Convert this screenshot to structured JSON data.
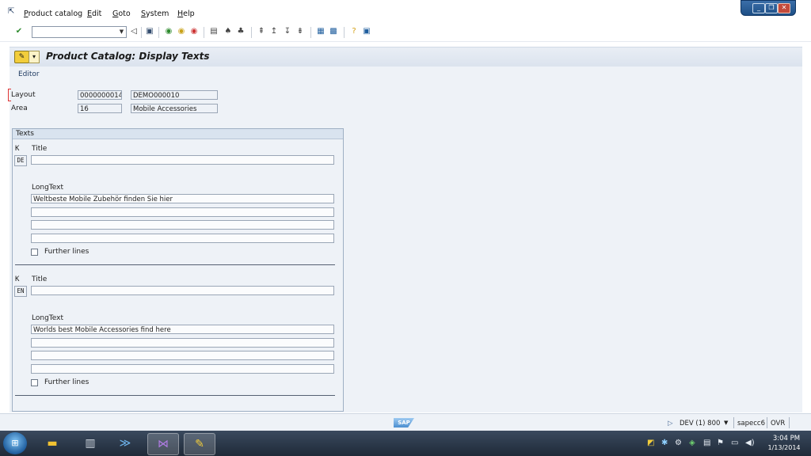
{
  "menu": [
    {
      "u": "P",
      "rest": "roduct catalog"
    },
    {
      "u": "E",
      "rest": "dit"
    },
    {
      "u": "G",
      "rest": "oto"
    },
    {
      "u": "S",
      "rest": "ystem"
    },
    {
      "u": "H",
      "rest": "elp"
    }
  ],
  "window_controls": {
    "minimize": "_",
    "restore": "❐",
    "close": "✕"
  },
  "toolbar": {
    "command_value": ""
  },
  "header": {
    "title": "Product Catalog: Display Texts"
  },
  "appbar": {
    "editor_label": "Editor"
  },
  "fields": {
    "layout_label": "Layout",
    "layout_value": "0000000014",
    "layout_desc": "DEMO000010",
    "area_label": "Area",
    "area_value": "16",
    "area_desc": "Mobile Accessories"
  },
  "texts": {
    "group_title": "Texts",
    "blocks": [
      {
        "k_label": "K",
        "title_label": "Title",
        "lang": "DE",
        "title_value": "",
        "longtext_label": "LongText",
        "lines": [
          "Weltbeste Mobile Zubehör finden Sie hier",
          "",
          "",
          ""
        ],
        "further_label": "Further lines"
      },
      {
        "k_label": "K",
        "title_label": "Title",
        "lang": "EN",
        "title_value": "",
        "longtext_label": "LongText",
        "lines": [
          "Worlds best Mobile Accessories find here",
          "",
          "",
          ""
        ],
        "further_label": "Further lines"
      }
    ]
  },
  "status": {
    "logo": "SAP",
    "system": "DEV (1) 800",
    "server": "sapecc6",
    "mode": "OVR"
  },
  "taskbar": {
    "time": "3:04 PM",
    "date": "1/13/2014"
  }
}
